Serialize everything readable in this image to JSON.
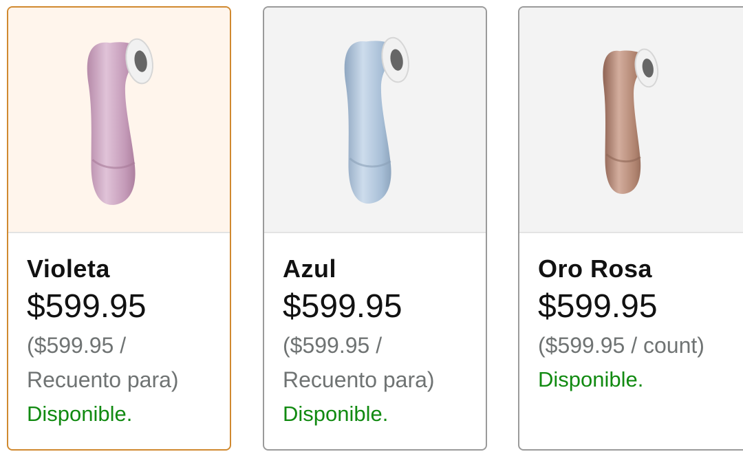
{
  "variants": [
    {
      "name": "Violeta",
      "price": "$599.95",
      "unit_price": "($599.95 / Recuento para)",
      "availability": "Disponible.",
      "selected": true,
      "product_color": "#c8a3bd",
      "icon": "product-image-violet"
    },
    {
      "name": "Azul",
      "price": "$599.95",
      "unit_price": "($599.95 / Recuento para)",
      "availability": "Disponible.",
      "selected": false,
      "product_color": "#a9bfd6",
      "icon": "product-image-blue"
    },
    {
      "name": "Oro Rosa",
      "price": "$599.95",
      "unit_price": "($599.95 / count)",
      "availability": "Disponible.",
      "selected": false,
      "product_color": "#b58a78",
      "icon": "product-image-rose-gold"
    }
  ],
  "colors": {
    "selected_border": "#d0892f",
    "border": "#9a9a9a",
    "available_green": "#118a11",
    "muted_text": "#6f7373"
  }
}
